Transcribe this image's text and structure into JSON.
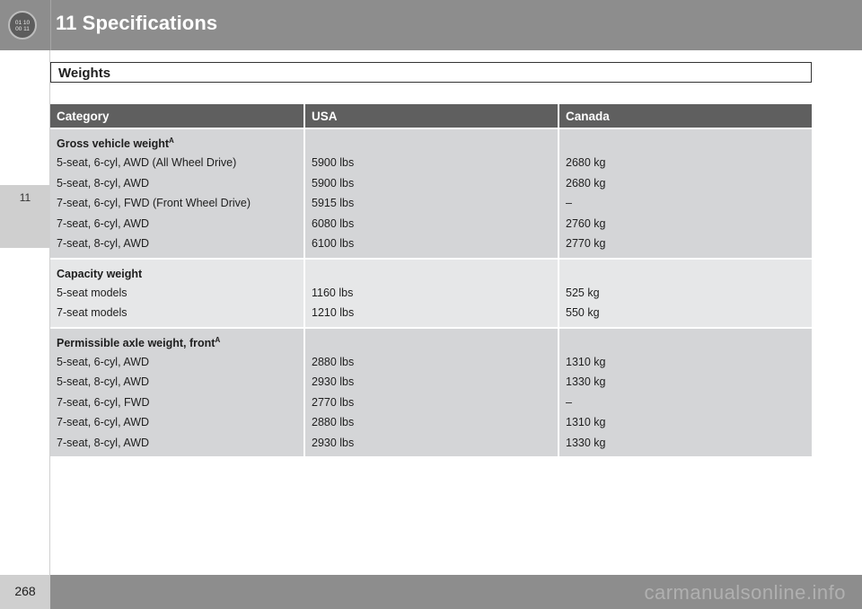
{
  "header": {
    "chapter_title": "11 Specifications",
    "chapter_icon": "chapter-badge-icon"
  },
  "side": {
    "chapter_number": "11"
  },
  "section": {
    "title": "Weights"
  },
  "table": {
    "columns": [
      "Category",
      "USA",
      "Canada"
    ],
    "groups": [
      {
        "heading": "Gross vehicle weight",
        "footnote": "A",
        "rows": [
          [
            "5-seat, 6-cyl, AWD (All Wheel Drive)",
            "5900 lbs",
            "2680 kg"
          ],
          [
            "5-seat, 8-cyl, AWD",
            "5900 lbs",
            "2680 kg"
          ],
          [
            "7-seat, 6-cyl, FWD (Front Wheel Drive)",
            "5915 lbs",
            "–"
          ],
          [
            "7-seat, 6-cyl, AWD",
            "6080 lbs",
            "2760 kg"
          ],
          [
            "7-seat, 8-cyl, AWD",
            "6100 lbs",
            "2770 kg"
          ]
        ]
      },
      {
        "heading": "Capacity weight",
        "footnote": "",
        "rows": [
          [
            "5-seat models",
            "1160 lbs",
            "525 kg"
          ],
          [
            "7-seat models",
            "1210 lbs",
            "550 kg"
          ]
        ]
      },
      {
        "heading": "Permissible axle weight, front",
        "footnote": "A",
        "rows": [
          [
            "5-seat, 6-cyl, AWD",
            "2880 lbs",
            "1310 kg"
          ],
          [
            "5-seat, 8-cyl, AWD",
            "2930 lbs",
            "1330 kg"
          ],
          [
            "7-seat, 6-cyl, FWD",
            "2770 lbs",
            "–"
          ],
          [
            "7-seat, 6-cyl, AWD",
            "2880 lbs",
            "1310 kg"
          ],
          [
            "7-seat, 8-cyl, AWD",
            "2930 lbs",
            "1330 kg"
          ]
        ]
      }
    ]
  },
  "footer": {
    "page_number": "268",
    "watermark": "carmanualsonline.info"
  },
  "colors": {
    "header_bar": "#8d8d8d",
    "table_header": "#5f5f5f",
    "row_dark": "#d4d5d7",
    "row_light": "#e6e7e8"
  }
}
